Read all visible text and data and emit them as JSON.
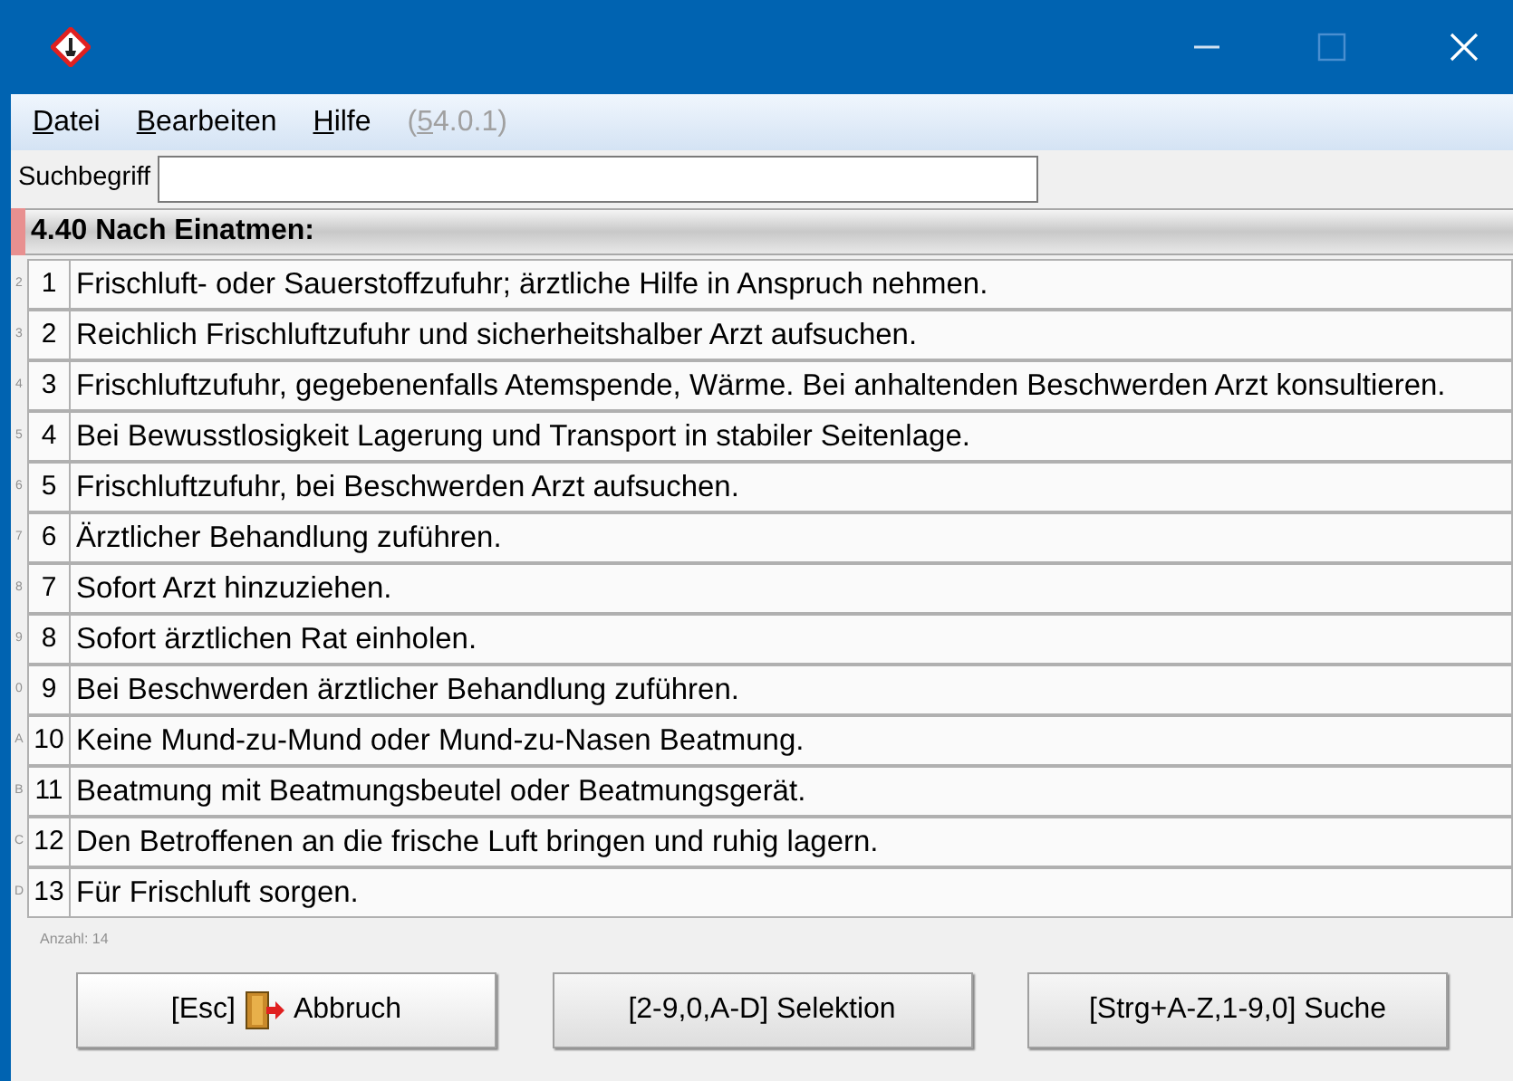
{
  "menu": [
    {
      "label": "Datei",
      "disabled": false
    },
    {
      "label": "Bearbeiten",
      "disabled": false
    },
    {
      "label": "Hilfe",
      "disabled": false
    },
    {
      "label": "(54.0.1)",
      "disabled": true
    }
  ],
  "search": {
    "label": "Suchbegriff"
  },
  "section": {
    "title": "4.40 Nach Einatmen:"
  },
  "rows": [
    {
      "key": "2",
      "number": "1",
      "text": "Frischluft- oder Sauerstoffzufuhr; ärztliche Hilfe in Anspruch nehmen."
    },
    {
      "key": "3",
      "number": "2",
      "text": "Reichlich Frischluftzufuhr und sicherheitshalber Arzt aufsuchen."
    },
    {
      "key": "4",
      "number": "3",
      "text": "Frischluftzufuhr, gegebenenfalls Atemspende, Wärme. Bei anhaltenden Beschwerden Arzt konsultieren."
    },
    {
      "key": "5",
      "number": "4",
      "text": "Bei Bewusstlosigkeit Lagerung und Transport in stabiler Seitenlage."
    },
    {
      "key": "6",
      "number": "5",
      "text": "Frischluftzufuhr, bei Beschwerden Arzt aufsuchen."
    },
    {
      "key": "7",
      "number": "6",
      "text": "Ärztlicher Behandlung zuführen."
    },
    {
      "key": "8",
      "number": "7",
      "text": "Sofort Arzt hinzuziehen."
    },
    {
      "key": "9",
      "number": "8",
      "text": "Sofort ärztlichen Rat einholen."
    },
    {
      "key": "0",
      "number": "9",
      "text": "Bei Beschwerden ärztlicher Behandlung zuführen."
    },
    {
      "key": "A",
      "number": "10",
      "text": "Keine Mund-zu-Mund oder Mund-zu-Nasen Beatmung."
    },
    {
      "key": "B",
      "number": "11",
      "text": "Beatmung mit Beatmungsbeutel oder Beatmungsgerät."
    },
    {
      "key": "C",
      "number": "12",
      "text": "Den Betroffenen an die frische Luft bringen und ruhig lagern."
    },
    {
      "key": "D",
      "number": "13",
      "text": "Für Frischluft sorgen."
    }
  ],
  "count": "Anzahl: 14",
  "buttons": [
    {
      "kind": "cancel",
      "label": "[Esc]",
      "label_after": "Abbruch"
    },
    {
      "kind": "plain",
      "label": "[2-9,0,A-D] Selektion"
    },
    {
      "kind": "plain",
      "label": "[Strg+A-Z,1-9,0] Suche"
    }
  ]
}
